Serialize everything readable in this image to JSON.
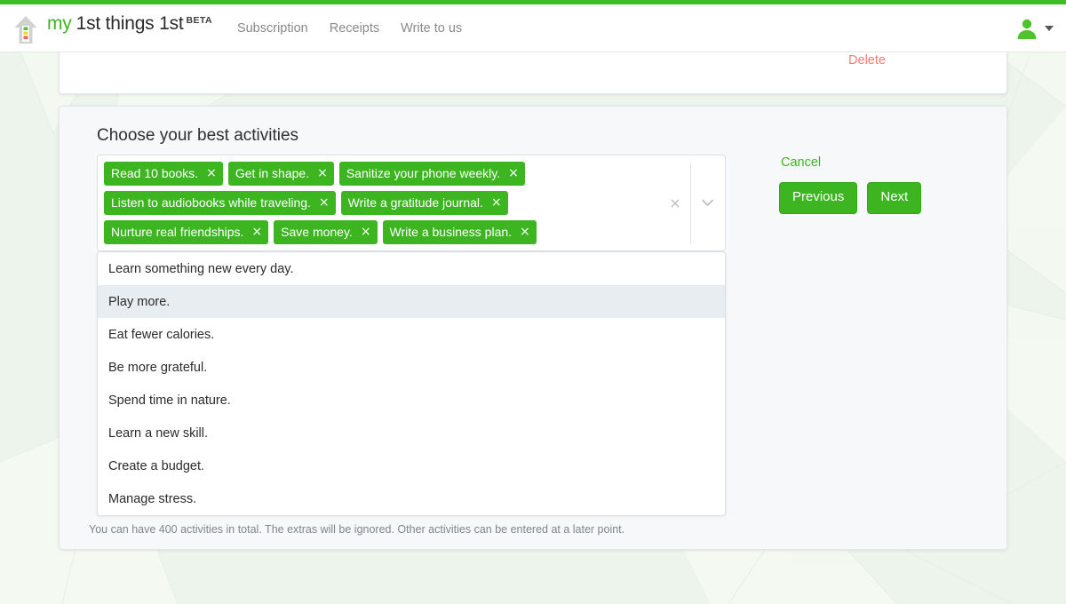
{
  "theme": {
    "brand_green": "#3cb521",
    "top_bar_green": "#3cbc25",
    "delete_red": "#fb7b72",
    "page_background": "#edf4ec",
    "card_background": "#f7f8f9",
    "highlight_background": "#e8edf1"
  },
  "header": {
    "logo_icon": "house-logo-icon",
    "brand_my": "my",
    "brand_rest": "1st things 1st",
    "brand_badge": "BETA",
    "nav": [
      {
        "label": "Subscription",
        "name": "nav-subscription"
      },
      {
        "label": "Receipts",
        "name": "nav-receipts"
      },
      {
        "label": "Write to us",
        "name": "nav-write-to-us"
      }
    ],
    "avatar_icon": "user-avatar-icon",
    "caret_icon": "chevron-down-icon"
  },
  "top_card": {
    "delete_label": "Delete"
  },
  "main_card": {
    "title": "Choose your best activities",
    "helper_text": "You can have 400 activities in total. The extras will be ignored. Other activities can be entered at a later point."
  },
  "multiselect": {
    "selected": [
      "Read 10 books.",
      "Get in shape.",
      "Sanitize your phone weekly.",
      "Listen to audiobooks while traveling.",
      "Write a gratitude journal.",
      "Nurture real friendships.",
      "Save money.",
      "Write a business plan."
    ],
    "remove_glyph": "×",
    "clear_all_glyph": "×",
    "clear_all_name": "clear-all-icon",
    "dropdown_toggle_name": "chevron-down-icon",
    "is_open": true,
    "highlighted_index": 1,
    "options": [
      "Learn something new every day.",
      "Play more.",
      "Eat fewer calories.",
      "Be more grateful.",
      "Spend time in nature.",
      "Learn a new skill.",
      "Create a budget.",
      "Manage stress."
    ]
  },
  "actions": {
    "cancel_label": "Cancel",
    "previous_label": "Previous",
    "next_label": "Next"
  }
}
